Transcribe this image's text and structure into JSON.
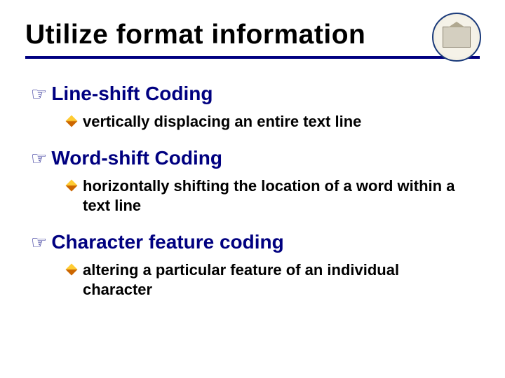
{
  "slide": {
    "title": "Utilize format information",
    "logo_alt": "university-seal",
    "items": [
      {
        "heading": "Line-shift Coding",
        "detail": "vertically displacing an entire text line"
      },
      {
        "heading": "Word-shift Coding",
        "detail": "horizontally shifting the location of a word within a text line"
      },
      {
        "heading": "Character feature coding",
        "detail": "altering a particular feature of an individual character"
      }
    ]
  }
}
